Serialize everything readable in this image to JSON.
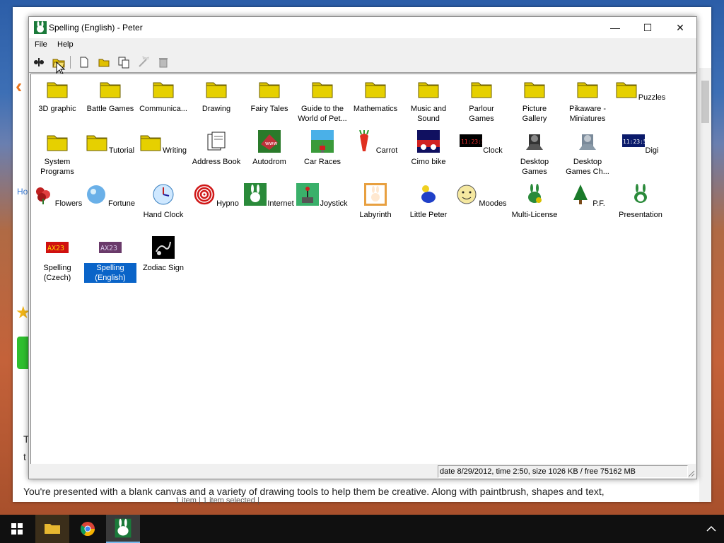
{
  "window": {
    "title": "Spelling (English) - Peter",
    "menu": [
      "File",
      "Help"
    ],
    "toolbar_icons": [
      "joystick-tool-icon",
      "open-folder-icon",
      "new-file-icon",
      "new-folder-icon",
      "copy-icon",
      "text-icon",
      "trash-icon"
    ],
    "controls": {
      "minimize": "—",
      "maximize": "☐",
      "close": "✕"
    }
  },
  "items": [
    {
      "label": "3D graphic",
      "icon": "folder"
    },
    {
      "label": "Battle Games",
      "icon": "folder"
    },
    {
      "label": "Communica...",
      "icon": "folder"
    },
    {
      "label": "Drawing",
      "icon": "folder"
    },
    {
      "label": "Fairy Tales",
      "icon": "folder"
    },
    {
      "label": "Guide to the World of Pet...",
      "icon": "folder"
    },
    {
      "label": "Mathematics",
      "icon": "folder"
    },
    {
      "label": "Music and Sound",
      "icon": "folder"
    },
    {
      "label": "Parlour Games",
      "icon": "folder"
    },
    {
      "label": "Picture Gallery",
      "icon": "folder"
    },
    {
      "label": "Pikaware - Miniatures",
      "icon": "folder"
    },
    {
      "label": "Puzzles",
      "icon": "folder"
    },
    {
      "label": "System Programs",
      "icon": "folder"
    },
    {
      "label": "Tutorial",
      "icon": "folder"
    },
    {
      "label": "Writing",
      "icon": "folder"
    },
    {
      "label": "Address Book",
      "icon": "address-book"
    },
    {
      "label": "Autodrom",
      "icon": "autodrom"
    },
    {
      "label": "Car Races",
      "icon": "car-races"
    },
    {
      "label": "Carrot",
      "icon": "carrot"
    },
    {
      "label": "Cimo bike",
      "icon": "cimo-bike"
    },
    {
      "label": "Clock",
      "icon": "clock-digital"
    },
    {
      "label": "Desktop Games",
      "icon": "desktop-games"
    },
    {
      "label": "Desktop Games Ch...",
      "icon": "desktop-games-ch"
    },
    {
      "label": "Digi",
      "icon": "digi"
    },
    {
      "label": "Flowers",
      "icon": "flowers"
    },
    {
      "label": "Fortune",
      "icon": "fortune"
    },
    {
      "label": "Hand Clock",
      "icon": "hand-clock"
    },
    {
      "label": "Hypno",
      "icon": "hypno"
    },
    {
      "label": "Internet",
      "icon": "internet"
    },
    {
      "label": "Joystick",
      "icon": "joystick"
    },
    {
      "label": "Labyrinth",
      "icon": "labyrinth"
    },
    {
      "label": "Little Peter",
      "icon": "little-peter"
    },
    {
      "label": "Moodes",
      "icon": "moodes"
    },
    {
      "label": "Multi-License",
      "icon": "multi-license"
    },
    {
      "label": "P.F.",
      "icon": "pf-tree"
    },
    {
      "label": "Presentation",
      "icon": "presentation"
    },
    {
      "label": "Spelling (Czech)",
      "icon": "spelling-czech"
    },
    {
      "label": "Spelling (English)",
      "icon": "spelling-english",
      "selected": true
    },
    {
      "label": "Zodiac Sign",
      "icon": "zodiac"
    }
  ],
  "icon_text": {
    "clock": "11:23:51",
    "digi": "11:23:51",
    "spelling": "AX23",
    "autodrom": "www"
  },
  "status": "date 8/29/2012, time 2:50, size 1026 KB / free 75162 MB",
  "background_page": {
    "bottom_text": "You're presented with a blank canvas and a variety of drawing tools to help them be creative. Along with paintbrush, shapes and text,",
    "fragment_ho": "Ho",
    "fragment_t1": "T",
    "fragment_t2": "t",
    "status_fragment": "1 item   |   1 item selected   |"
  },
  "colors": {
    "selection": "#0a64c8",
    "folder": "#d8c000"
  }
}
